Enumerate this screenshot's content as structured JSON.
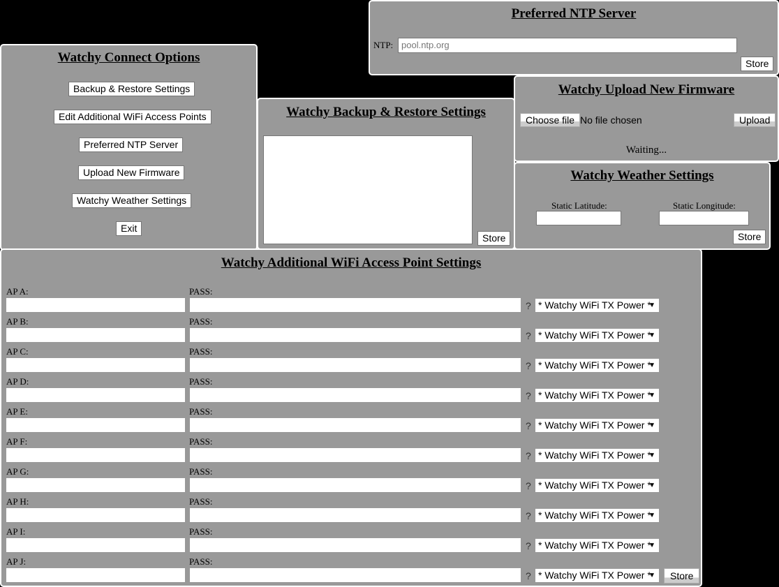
{
  "ntp_panel": {
    "title": "Preferred NTP Server",
    "label": "NTP:",
    "placeholder": "pool.ntp.org",
    "value": "",
    "store_label": "Store"
  },
  "connect_panel": {
    "title": "Watchy Connect Options",
    "buttons": [
      {
        "label": "Backup & Restore Settings"
      },
      {
        "label": "Edit Additional WiFi Access Points"
      },
      {
        "label": "Preferred NTP Server"
      },
      {
        "label": "Upload New Firmware"
      },
      {
        "label": "Watchy Weather Settings"
      },
      {
        "label": "Exit"
      }
    ]
  },
  "backup_panel": {
    "title": "Watchy Backup & Restore Settings",
    "textarea_value": "",
    "store_label": "Store"
  },
  "firmware_panel": {
    "title": "Watchy Upload New Firmware",
    "choose_label": "Choose file",
    "file_status": "No file chosen",
    "upload_label": "Upload",
    "status": "Waiting..."
  },
  "weather_panel": {
    "title": "Watchy Weather Settings",
    "lat_label": "Static Latitude:",
    "lon_label": "Static Longitude:",
    "lat_value": "",
    "lon_value": "",
    "store_label": "Store"
  },
  "wifi_panel": {
    "title": "Watchy Additional WiFi Access Point Settings",
    "pass_label": "PASS:",
    "help_glyph": "?",
    "tx_power_selected": "* Watchy WiFi TX Power *",
    "store_label": "Store",
    "access_points": [
      {
        "label": "AP A:",
        "ssid": "",
        "pass": ""
      },
      {
        "label": "AP B:",
        "ssid": "",
        "pass": ""
      },
      {
        "label": "AP C:",
        "ssid": "",
        "pass": ""
      },
      {
        "label": "AP D:",
        "ssid": "",
        "pass": ""
      },
      {
        "label": "AP E:",
        "ssid": "",
        "pass": ""
      },
      {
        "label": "AP F:",
        "ssid": "",
        "pass": ""
      },
      {
        "label": "AP G:",
        "ssid": "",
        "pass": ""
      },
      {
        "label": "AP H:",
        "ssid": "",
        "pass": ""
      },
      {
        "label": "AP I:",
        "ssid": "",
        "pass": ""
      },
      {
        "label": "AP J:",
        "ssid": "",
        "pass": ""
      }
    ]
  }
}
